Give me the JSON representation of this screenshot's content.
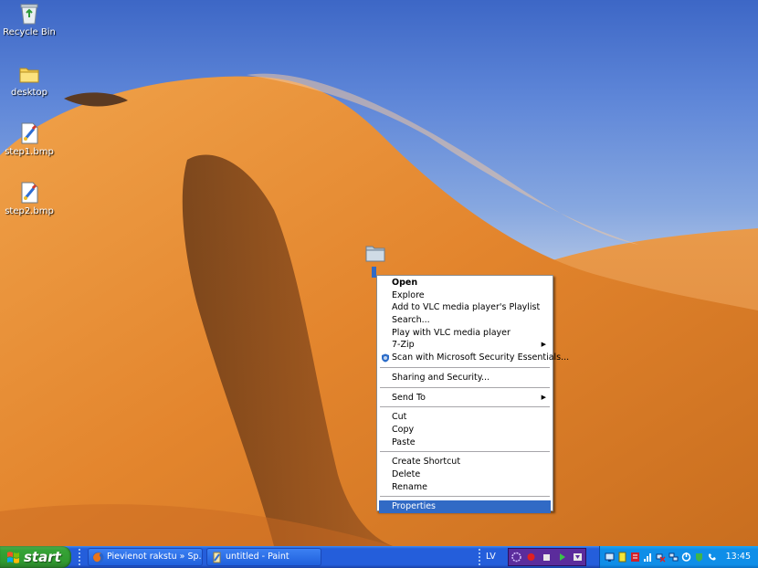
{
  "desktop_icons": [
    {
      "label": "Recycle Bin",
      "icon": "recycle-bin-icon"
    },
    {
      "label": "desktop",
      "icon": "folder-icon"
    },
    {
      "label": "step1.bmp",
      "icon": "bitmap-file-icon"
    },
    {
      "label": "step2.bmp",
      "icon": "bitmap-file-icon"
    }
  ],
  "context_menu": {
    "items": [
      {
        "label": "Open",
        "bold": true
      },
      {
        "label": "Explore"
      },
      {
        "label": "Add to VLC media player's Playlist"
      },
      {
        "label": "Search..."
      },
      {
        "label": "Play with VLC media player"
      },
      {
        "label": "7-Zip",
        "submenu": true
      },
      {
        "label": "Scan with Microsoft Security Essentials...",
        "icon": "security-shield-icon"
      },
      {
        "label": "Sharing and Security..."
      },
      {
        "label": "Send To",
        "submenu": true
      },
      {
        "label": "Cut"
      },
      {
        "label": "Copy"
      },
      {
        "label": "Paste"
      },
      {
        "label": "Create Shortcut"
      },
      {
        "label": "Delete"
      },
      {
        "label": "Rename"
      },
      {
        "label": "Properties",
        "selected": true
      }
    ],
    "submenu_arrow": "▶"
  },
  "taskbar": {
    "start_label": "start",
    "buttons": [
      {
        "label": "Pievienot rakstu » Sp...",
        "icon": "firefox-icon"
      },
      {
        "label": "untitled - Paint",
        "icon": "paint-icon"
      }
    ],
    "language": "LV",
    "clock": "13:45",
    "media_controls": [
      "record",
      "stop",
      "play",
      "menu"
    ]
  },
  "colors": {
    "taskbar": "#245edb",
    "start": "#36a336",
    "tray": "#0f8ee8",
    "menu_highlight": "#316ac5",
    "sand": "#e58a2e"
  }
}
